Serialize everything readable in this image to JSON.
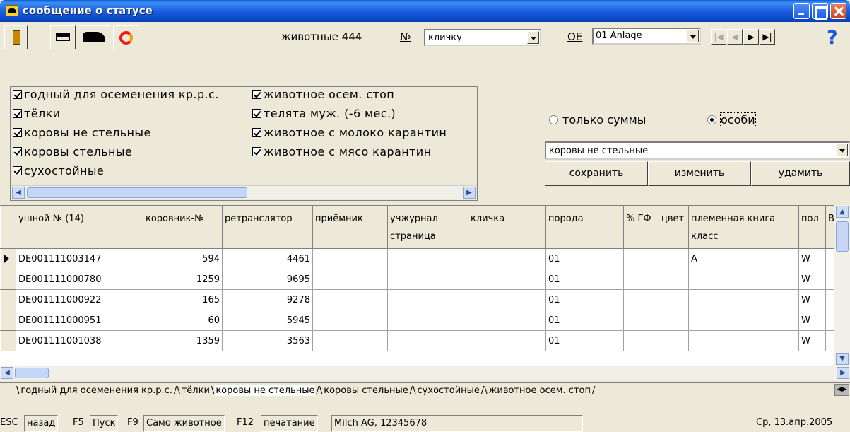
{
  "window": {
    "title": "сообщение о статусе"
  },
  "toolbar": {
    "animals_label": "животные 444",
    "number_label": "№",
    "name_combo_value": "кличку",
    "oe_label": "OE",
    "oe_combo_value": "01 Anlage"
  },
  "filters": {
    "left": [
      "годный для осеменения кр.р.с.",
      "тёлки",
      "коровы не стельные",
      "коровы стельные",
      "сухостойные"
    ],
    "right": [
      "животное осем. стоп",
      "телята муж. (-6 мес.)",
      "животное с молоко карантин",
      "животное с мясо карантин"
    ]
  },
  "view": {
    "only_sums_label": "только суммы",
    "individuals_label": "особи",
    "selected_mode": "individuals",
    "selection_value": "коровы не стельные",
    "save_label": "сохранить",
    "edit_label": "изменить",
    "delete_label": "удамить"
  },
  "grid": {
    "columns": [
      "ушной № (14)",
      "коровник-№",
      "ретранслятор",
      "приёмник",
      "учжурнал страница",
      "кличка",
      "порода",
      "% ГФ",
      "цвет",
      "племенная книга класс",
      "пол",
      "BI"
    ],
    "rows": [
      [
        "DE001111003147",
        "594",
        "4461",
        "",
        "",
        "",
        "01",
        "",
        "",
        "A",
        "W",
        ""
      ],
      [
        "DE001111000780",
        "1259",
        "9695",
        "",
        "",
        "",
        "01",
        "",
        "",
        "",
        "W",
        ""
      ],
      [
        "DE001111000922",
        "165",
        "9278",
        "",
        "",
        "",
        "01",
        "",
        "",
        "",
        "W",
        ""
      ],
      [
        "DE001111000951",
        "60",
        "5945",
        "",
        "",
        "",
        "01",
        "",
        "",
        "",
        "W",
        ""
      ],
      [
        "DE001111001038",
        "1359",
        "3563",
        "",
        "",
        "",
        "01",
        "",
        "",
        "",
        "W",
        ""
      ]
    ]
  },
  "tabs": [
    "годный для осеменения кр.р.с.",
    "тёлки",
    "коровы не стельные",
    "коровы стельные",
    "сухостойные",
    "животное осем. стоп"
  ],
  "status": {
    "esc": "ESC",
    "back": "назад",
    "f5": "F5",
    "start": "Пуск",
    "f9": "F9",
    "animal": "Само животное",
    "f12": "F12",
    "print": "печатание",
    "company": "Milch AG, 12345678",
    "date": "Ср, 13.апр.2005"
  }
}
